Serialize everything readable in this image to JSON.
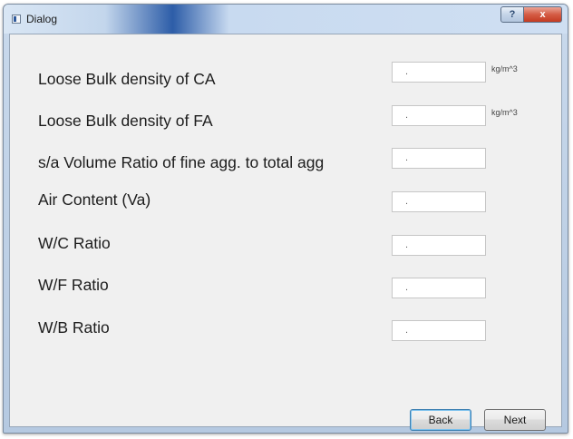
{
  "window": {
    "title": "Dialog",
    "help_glyph": "?",
    "close_glyph": "x"
  },
  "fields": [
    {
      "label": "Loose Bulk density of CA",
      "value": ".",
      "unit": "kg/m^3"
    },
    {
      "label": "Loose Bulk density of FA",
      "value": ".",
      "unit": "kg/m^3"
    },
    {
      "label": "s/a Volume Ratio of fine agg. to total agg",
      "value": ".",
      "unit": ""
    },
    {
      "label": "Air Content (Va)",
      "value": ".",
      "unit": ""
    },
    {
      "label": "W/C Ratio",
      "value": ".",
      "unit": ""
    },
    {
      "label": "W/F Ratio",
      "value": ".",
      "unit": ""
    },
    {
      "label": "W/B Ratio",
      "value": ".",
      "unit": ""
    }
  ],
  "buttons": {
    "back": "Back",
    "next": "Next"
  },
  "colors": {
    "window_frame": "#b5c9e1",
    "client_bg": "#f0f0f0",
    "close_red": "#c43b22",
    "focus_blue": "#3c7fb1"
  },
  "icons": {
    "app": "window-icon",
    "help": "help-icon",
    "close": "close-icon"
  }
}
